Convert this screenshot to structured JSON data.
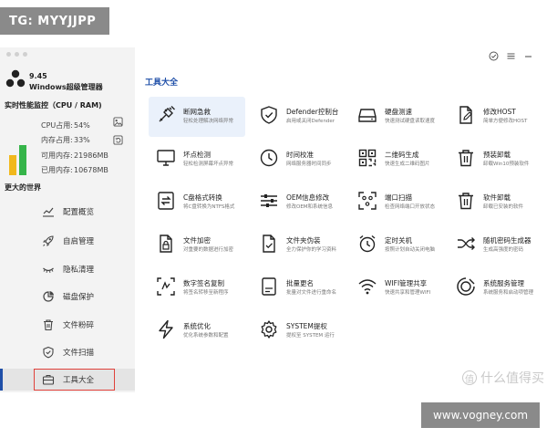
{
  "watermarks": {
    "top": "TG: MYYJJPP",
    "bottom": "www.vogney.com",
    "zhi": "什么值得买",
    "zhi_icon": "值"
  },
  "app": {
    "version": "9.45",
    "name": "Windows超级管理器",
    "monitor_title": "实时性能监控（CPU / RAM)",
    "section_title": "更大的世界"
  },
  "stats": [
    {
      "label": "CPU占用:",
      "value": "54%"
    },
    {
      "label": "内存占用:",
      "value": "33%"
    },
    {
      "label": "可用内存:",
      "value": "21986MB"
    },
    {
      "label": "已用内存:",
      "value": "10678MB"
    }
  ],
  "meters": {
    "cpu_level": 0.54,
    "ram_level": 0.82,
    "cpu_color": "#f1b81c",
    "ram_color": "#35b449"
  },
  "nav": [
    {
      "label": "配置概览",
      "icon": "chart-line-icon"
    },
    {
      "label": "自启管理",
      "icon": "rocket-icon"
    },
    {
      "label": "隐私清理",
      "icon": "eye-closed-icon"
    },
    {
      "label": "磁盘保护",
      "icon": "pie-icon"
    },
    {
      "label": "文件粉碎",
      "icon": "trash-icon"
    },
    {
      "label": "文件扫描",
      "icon": "shield-check-icon"
    },
    {
      "label": "工具大全",
      "icon": "toolbox-icon",
      "active": true
    }
  ],
  "main": {
    "title": "工具大全"
  },
  "tools": [
    {
      "name": "断网急救",
      "desc": "轻松处理解决网络异常",
      "icon": "plug-icon"
    },
    {
      "name": "Defender控制台",
      "desc": "启用或关闭Defender",
      "icon": "shield-check-icon"
    },
    {
      "name": "硬盘测速",
      "desc": "快速测试硬盘读取速度",
      "icon": "harddisk-icon"
    },
    {
      "name": "修改HOST",
      "desc": "简单方便修改HOST",
      "icon": "file-edit-icon"
    },
    {
      "name": "坏点检测",
      "desc": "轻松检测屏幕坏点异常",
      "icon": "monitor-icon"
    },
    {
      "name": "时间校准",
      "desc": "网络服务器时间同步",
      "icon": "clock-icon"
    },
    {
      "name": "二维码生成",
      "desc": "快速生成二维码图片",
      "icon": "qrcode-icon"
    },
    {
      "name": "预装卸载",
      "desc": "卸载Win10预装软件",
      "icon": "trash-icon"
    },
    {
      "name": "C盘格式转换",
      "desc": "将C盘转换为NTFS格式",
      "icon": "swap-icon"
    },
    {
      "name": "OEM信息修改",
      "desc": "修改OEM和系统信息",
      "icon": "sliders-icon"
    },
    {
      "name": "端口扫描",
      "desc": "检查网络端口开放状态",
      "icon": "scan-icon"
    },
    {
      "name": "软件卸载",
      "desc": "卸载已安装的软件",
      "icon": "trash-icon"
    },
    {
      "name": "文件加密",
      "desc": "对重要的数据进行加密",
      "icon": "lock-file-icon"
    },
    {
      "name": "文件夹伪装",
      "desc": "全力保护你的学习资料",
      "icon": "file-check-icon"
    },
    {
      "name": "定时关机",
      "desc": "按照计划自动关闭电脑",
      "icon": "alarm-icon"
    },
    {
      "name": "随机密码生成器",
      "desc": "生成高强度的密码",
      "icon": "shuffle-icon"
    },
    {
      "name": "数字签名复制",
      "desc": "将签名转移至新程序",
      "icon": "copy-sign-icon"
    },
    {
      "name": "批量更名",
      "desc": "批量对文件进行重命名",
      "icon": "rename-icon"
    },
    {
      "name": "WIFI管理共享",
      "desc": "快速共享和管理WIFI",
      "icon": "wifi-icon"
    },
    {
      "name": "系统服务管理",
      "desc": "系统服务和启动项管理",
      "icon": "services-icon"
    },
    {
      "name": "系统优化",
      "desc": "优化系统参数和配置",
      "icon": "bolt-icon"
    },
    {
      "name": "SYSTEM提权",
      "desc": "提权至 SYSTEM 运行",
      "icon": "gear-icon"
    }
  ]
}
